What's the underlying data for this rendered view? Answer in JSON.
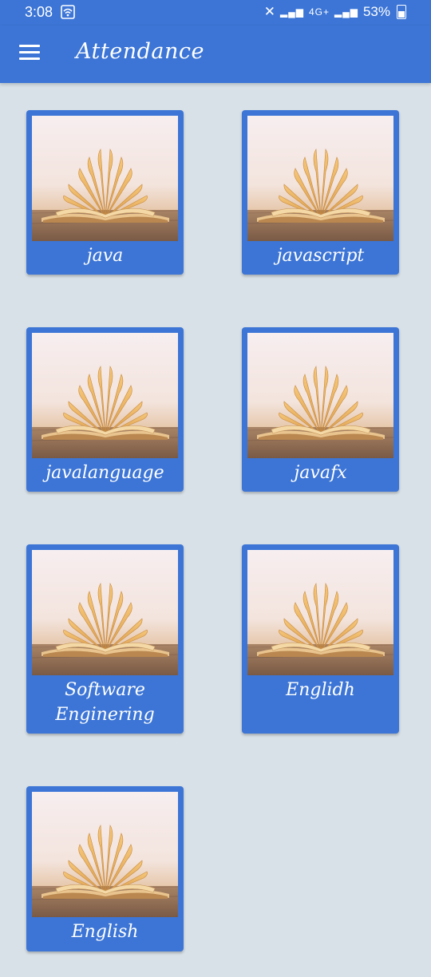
{
  "status_bar": {
    "time": "3:08",
    "network": "4G+",
    "battery_percent": "53%"
  },
  "app_bar": {
    "title": "Attendance",
    "menu_icon": "hamburger-menu-icon"
  },
  "courses": [
    {
      "label": "java"
    },
    {
      "label": "javascript"
    },
    {
      "label": "javalanguage"
    },
    {
      "label": "javafx"
    },
    {
      "label": "Software Enginering"
    },
    {
      "label": "Englidh"
    },
    {
      "label": "English"
    }
  ],
  "colors": {
    "primary": "#3c75d6",
    "background": "#d8e1e8",
    "text_on_primary": "#ffffff"
  }
}
